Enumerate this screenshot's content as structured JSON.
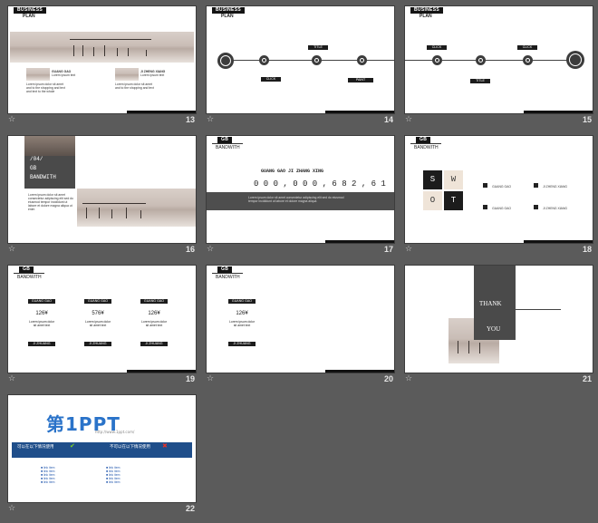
{
  "slides": [
    {
      "number": "13",
      "tag": "BUSINESS",
      "tag2": "PLAN",
      "items": [
        {
          "title": "GUANG GAO",
          "sub": "Lorem Ipsum text"
        },
        {
          "title": "JI ZHENG XIANG",
          "sub": "Lorem Ipsum text"
        }
      ]
    },
    {
      "number": "14",
      "tag": "BUSINESS",
      "tag2": "PLAN",
      "labels": [
        "CLICK",
        "TITLE",
        "PAINT",
        "CLICK"
      ]
    },
    {
      "number": "15",
      "tag": "BUSINESS",
      "tag2": "PLAN",
      "labels": [
        "CLICK",
        "TITLE",
        "CLICK"
      ]
    },
    {
      "number": "16",
      "tag": "/04/",
      "tag2": "GB",
      "sub": "BANDWITH"
    },
    {
      "number": "17",
      "tag": "GB",
      "sub": "BANDWITH",
      "title": "GUANG GAO JI ZHANG XING",
      "digits": "0 0 0 , 0 0 0 , 6 8 2 , 6 1"
    },
    {
      "number": "18",
      "tag": "GB",
      "sub": "BANDWITH",
      "swot": [
        "S",
        "W",
        "O",
        "T"
      ],
      "entries": [
        "GUANG GAO",
        "JI ZHENG XIANG",
        "GUANG GAO",
        "JI ZHENG XIANG"
      ]
    },
    {
      "number": "19",
      "tag": "GB",
      "sub": "BANDWITH",
      "cols": [
        {
          "head": "GUANG GAO",
          "value": "126¥",
          "foot": "JI ZHUANG"
        },
        {
          "head": "GUANG GAO",
          "value": "576¥",
          "foot": "JI ZHUANG"
        },
        {
          "head": "GUANG GAO",
          "value": "126¥",
          "foot": "JI ZHUANG"
        }
      ]
    },
    {
      "number": "20",
      "tag": "GB",
      "sub": "BANDWITH",
      "cols": [
        {
          "head": "GUANG GAO",
          "value": "126¥",
          "foot": "JI ZHUANG"
        }
      ]
    },
    {
      "number": "21",
      "thank": "THANK",
      "you": "YOU"
    },
    {
      "number": "22",
      "brand": "第1PPT",
      "url": "http://www.1ppt.com/",
      "left": "可以在以下情况使用",
      "right": "不可以在以下情况使用"
    }
  ],
  "colors": {
    "background": "#5b5b5b",
    "slide": "#ffffff",
    "dark": "#141414",
    "blue": "#1f4e8a"
  },
  "icons": {
    "footer": "star-icon"
  }
}
